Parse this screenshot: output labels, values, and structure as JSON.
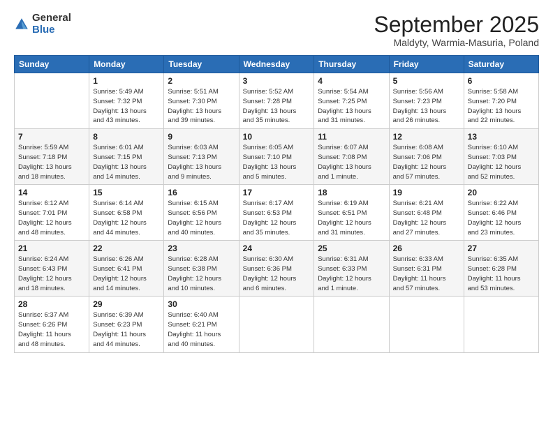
{
  "logo": {
    "general": "General",
    "blue": "Blue"
  },
  "header": {
    "month_title": "September 2025",
    "subtitle": "Maldyty, Warmia-Masuria, Poland"
  },
  "days_of_week": [
    "Sunday",
    "Monday",
    "Tuesday",
    "Wednesday",
    "Thursday",
    "Friday",
    "Saturday"
  ],
  "weeks": [
    [
      {
        "day": "",
        "info": ""
      },
      {
        "day": "1",
        "info": "Sunrise: 5:49 AM\nSunset: 7:32 PM\nDaylight: 13 hours\nand 43 minutes."
      },
      {
        "day": "2",
        "info": "Sunrise: 5:51 AM\nSunset: 7:30 PM\nDaylight: 13 hours\nand 39 minutes."
      },
      {
        "day": "3",
        "info": "Sunrise: 5:52 AM\nSunset: 7:28 PM\nDaylight: 13 hours\nand 35 minutes."
      },
      {
        "day": "4",
        "info": "Sunrise: 5:54 AM\nSunset: 7:25 PM\nDaylight: 13 hours\nand 31 minutes."
      },
      {
        "day": "5",
        "info": "Sunrise: 5:56 AM\nSunset: 7:23 PM\nDaylight: 13 hours\nand 26 minutes."
      },
      {
        "day": "6",
        "info": "Sunrise: 5:58 AM\nSunset: 7:20 PM\nDaylight: 13 hours\nand 22 minutes."
      }
    ],
    [
      {
        "day": "7",
        "info": "Sunrise: 5:59 AM\nSunset: 7:18 PM\nDaylight: 13 hours\nand 18 minutes."
      },
      {
        "day": "8",
        "info": "Sunrise: 6:01 AM\nSunset: 7:15 PM\nDaylight: 13 hours\nand 14 minutes."
      },
      {
        "day": "9",
        "info": "Sunrise: 6:03 AM\nSunset: 7:13 PM\nDaylight: 13 hours\nand 9 minutes."
      },
      {
        "day": "10",
        "info": "Sunrise: 6:05 AM\nSunset: 7:10 PM\nDaylight: 13 hours\nand 5 minutes."
      },
      {
        "day": "11",
        "info": "Sunrise: 6:07 AM\nSunset: 7:08 PM\nDaylight: 13 hours\nand 1 minute."
      },
      {
        "day": "12",
        "info": "Sunrise: 6:08 AM\nSunset: 7:06 PM\nDaylight: 12 hours\nand 57 minutes."
      },
      {
        "day": "13",
        "info": "Sunrise: 6:10 AM\nSunset: 7:03 PM\nDaylight: 12 hours\nand 52 minutes."
      }
    ],
    [
      {
        "day": "14",
        "info": "Sunrise: 6:12 AM\nSunset: 7:01 PM\nDaylight: 12 hours\nand 48 minutes."
      },
      {
        "day": "15",
        "info": "Sunrise: 6:14 AM\nSunset: 6:58 PM\nDaylight: 12 hours\nand 44 minutes."
      },
      {
        "day": "16",
        "info": "Sunrise: 6:15 AM\nSunset: 6:56 PM\nDaylight: 12 hours\nand 40 minutes."
      },
      {
        "day": "17",
        "info": "Sunrise: 6:17 AM\nSunset: 6:53 PM\nDaylight: 12 hours\nand 35 minutes."
      },
      {
        "day": "18",
        "info": "Sunrise: 6:19 AM\nSunset: 6:51 PM\nDaylight: 12 hours\nand 31 minutes."
      },
      {
        "day": "19",
        "info": "Sunrise: 6:21 AM\nSunset: 6:48 PM\nDaylight: 12 hours\nand 27 minutes."
      },
      {
        "day": "20",
        "info": "Sunrise: 6:22 AM\nSunset: 6:46 PM\nDaylight: 12 hours\nand 23 minutes."
      }
    ],
    [
      {
        "day": "21",
        "info": "Sunrise: 6:24 AM\nSunset: 6:43 PM\nDaylight: 12 hours\nand 18 minutes."
      },
      {
        "day": "22",
        "info": "Sunrise: 6:26 AM\nSunset: 6:41 PM\nDaylight: 12 hours\nand 14 minutes."
      },
      {
        "day": "23",
        "info": "Sunrise: 6:28 AM\nSunset: 6:38 PM\nDaylight: 12 hours\nand 10 minutes."
      },
      {
        "day": "24",
        "info": "Sunrise: 6:30 AM\nSunset: 6:36 PM\nDaylight: 12 hours\nand 6 minutes."
      },
      {
        "day": "25",
        "info": "Sunrise: 6:31 AM\nSunset: 6:33 PM\nDaylight: 12 hours\nand 1 minute."
      },
      {
        "day": "26",
        "info": "Sunrise: 6:33 AM\nSunset: 6:31 PM\nDaylight: 11 hours\nand 57 minutes."
      },
      {
        "day": "27",
        "info": "Sunrise: 6:35 AM\nSunset: 6:28 PM\nDaylight: 11 hours\nand 53 minutes."
      }
    ],
    [
      {
        "day": "28",
        "info": "Sunrise: 6:37 AM\nSunset: 6:26 PM\nDaylight: 11 hours\nand 48 minutes."
      },
      {
        "day": "29",
        "info": "Sunrise: 6:39 AM\nSunset: 6:23 PM\nDaylight: 11 hours\nand 44 minutes."
      },
      {
        "day": "30",
        "info": "Sunrise: 6:40 AM\nSunset: 6:21 PM\nDaylight: 11 hours\nand 40 minutes."
      },
      {
        "day": "",
        "info": ""
      },
      {
        "day": "",
        "info": ""
      },
      {
        "day": "",
        "info": ""
      },
      {
        "day": "",
        "info": ""
      }
    ]
  ]
}
